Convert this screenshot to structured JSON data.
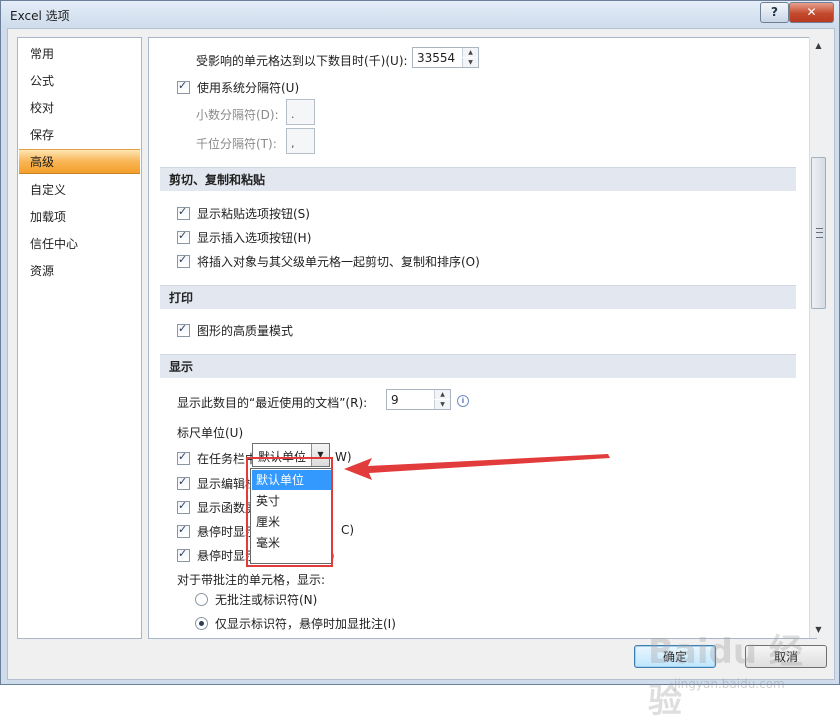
{
  "window": {
    "title": "Excel 选项",
    "help_label": "?",
    "close_label": "✕"
  },
  "nav": {
    "items": [
      {
        "label": "常用"
      },
      {
        "label": "公式"
      },
      {
        "label": "校对"
      },
      {
        "label": "保存"
      },
      {
        "label": "高级",
        "active": true
      },
      {
        "label": "自定义"
      },
      {
        "label": "加载项"
      },
      {
        "label": "信任中心"
      },
      {
        "label": "资源"
      }
    ]
  },
  "top": {
    "affected_cells_label": "受影响的单元格达到以下数目时(千)(U):",
    "affected_cells_value": "33554",
    "use_system_separators_label": "使用系统分隔符(U)",
    "decimal_separator_label": "小数分隔符(D):",
    "decimal_separator_value": ".",
    "thousands_separator_label": "千位分隔符(T):",
    "thousands_separator_value": ","
  },
  "sections": {
    "cut_copy_paste": {
      "title": "剪切、复制和粘贴",
      "options": [
        "显示粘贴选项按钮(S)",
        "显示插入选项按钮(H)",
        "将插入对象与其父级单元格一起剪切、复制和排序(O)"
      ]
    },
    "print": {
      "title": "打印",
      "options": [
        "图形的高质量模式"
      ]
    },
    "display": {
      "title": "显示",
      "recent_docs_label": "显示此数目的“最近使用的文档”(R):",
      "recent_docs_value": "9",
      "ruler_units_label": "标尺单位(U)",
      "ruler_units_value": "默认单位",
      "ruler_units_options": [
        "默认单位",
        "英寸",
        "厘米",
        "毫米"
      ],
      "options": [
        "在任务栏中显示所有窗口(W)",
        "显示编辑栏(B)",
        "显示函数屏幕提示(F)",
        "悬停时显示图表元素名称(C)",
        "悬停时显示数据点的值(V)"
      ],
      "options_visible": [
        "在任务栏中",
        "W)",
        "显示编辑栏",
        "显示函数屏",
        "悬停时显示",
        "C)",
        "悬停时显示数据点的值(V)"
      ],
      "comment_cells_label": "对于带批注的单元格，显示:",
      "comment_options": [
        "无批注或标识符(N)",
        "仅显示标识符，悬停时加显批注(I)"
      ]
    }
  },
  "buttons": {
    "ok": "确定",
    "cancel": "取消"
  },
  "watermark": {
    "logo": "Baidu 经验",
    "url": "jingyan.baidu.com"
  },
  "colors": {
    "accent": "#3399ff",
    "highlight_frame": "#e23b3b",
    "nav_active": "#f9b555"
  }
}
